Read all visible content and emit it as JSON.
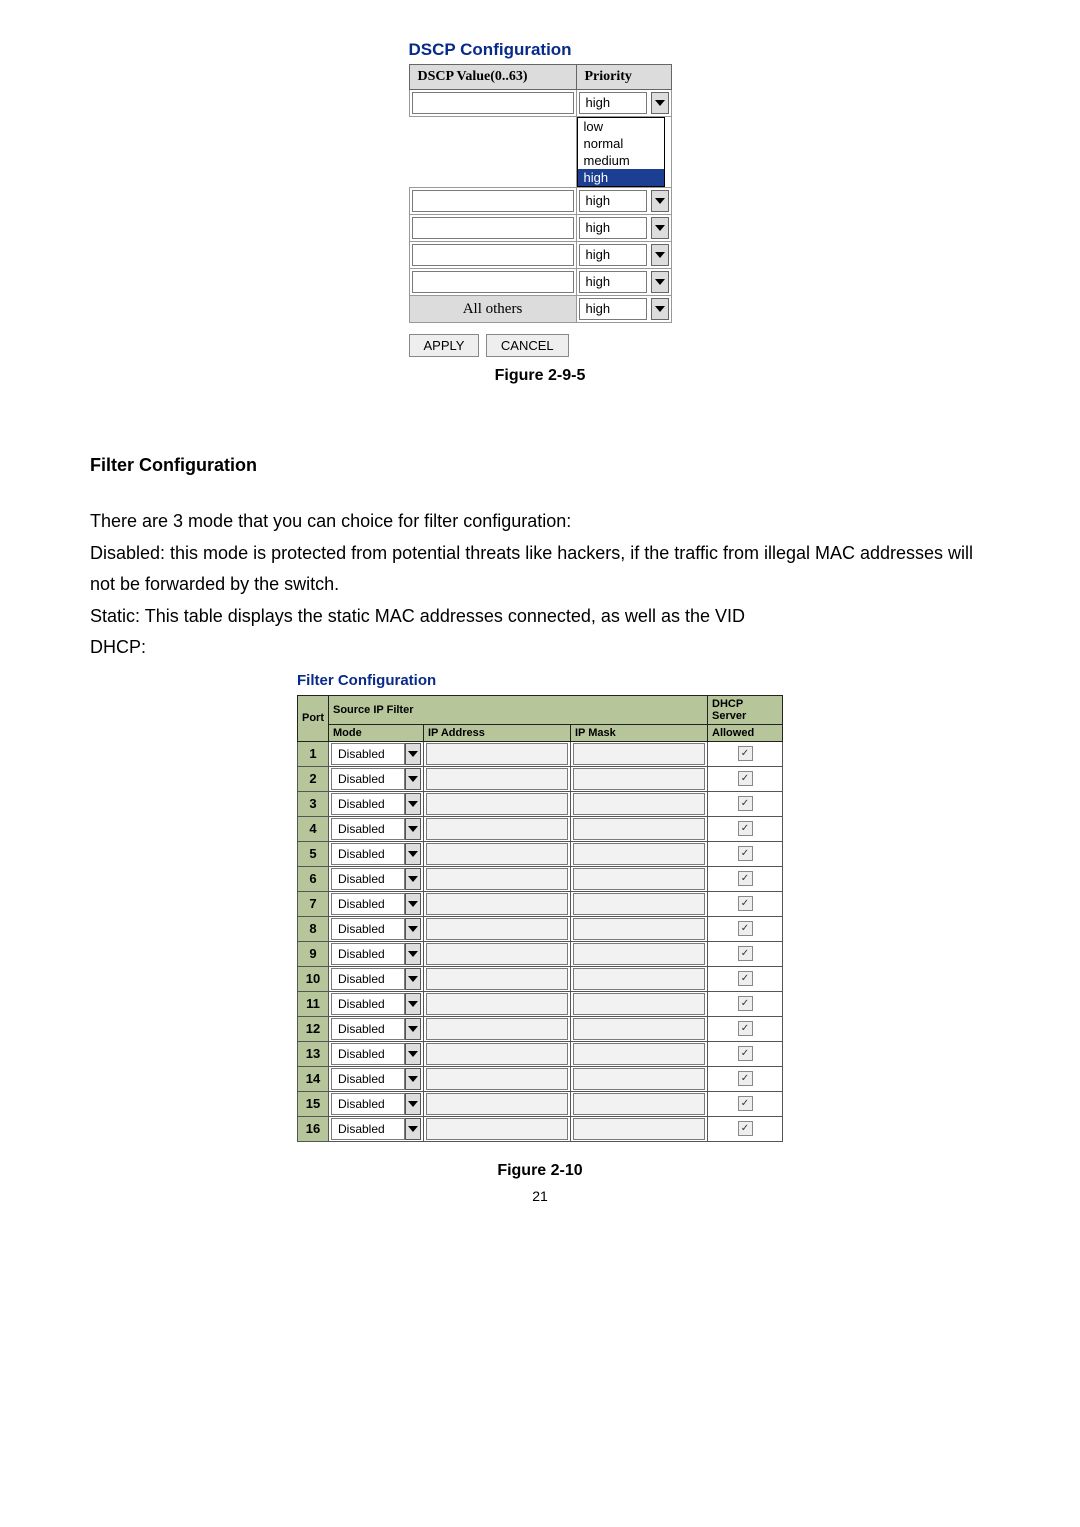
{
  "dscp": {
    "title": "DSCP Configuration",
    "col_value": "DSCP Value(0..63)",
    "col_priority": "Priority",
    "open_options": [
      "low",
      "normal",
      "medium",
      "high"
    ],
    "open_selected": "high",
    "rows_closed_value": "high",
    "all_others_label": "All others",
    "all_others_value": "high",
    "apply_label": "APPLY",
    "cancel_label": "CANCEL",
    "figure_label": "Figure 2-9-5"
  },
  "section": {
    "heading": "Filter Configuration",
    "para1": "There are 3 mode that you can choice for filter configuration:",
    "para2": "Disabled: this mode is protected from potential threats like hackers, if the traffic from illegal MAC addresses will not be forwarded by the switch.",
    "para3": "Static: This table displays the static MAC addresses connected, as well as the VID",
    "para4": "DHCP:"
  },
  "filter": {
    "title": "Filter Configuration",
    "col_port": "Port",
    "col_source": "Source IP Filter",
    "col_mode": "Mode",
    "col_ip": "IP Address",
    "col_mask": "IP Mask",
    "col_dhcp_top": "DHCP Server",
    "col_dhcp_bottom": "Allowed",
    "mode_value": "Disabled",
    "row_count": 16,
    "figure_label": "Figure 2-10"
  },
  "page_number": "21"
}
